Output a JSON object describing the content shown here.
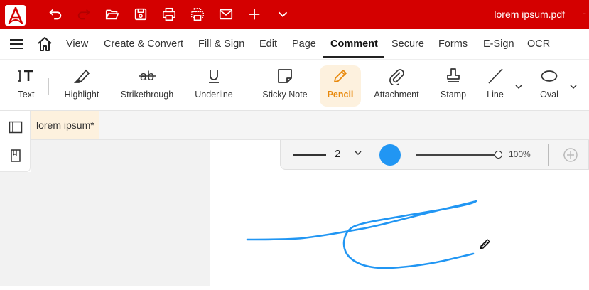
{
  "app": {
    "document_title": "lorem ipsum.pdf",
    "minimize": "-"
  },
  "menu": {
    "items": [
      "View",
      "Create & Convert",
      "Fill & Sign",
      "Edit",
      "Page",
      "Comment",
      "Secure",
      "Forms",
      "E-Sign",
      "OCR"
    ],
    "active": "Comment"
  },
  "toolbar": {
    "text": "Text",
    "highlight": "Highlight",
    "strikethrough": "Strikethrough",
    "underline": "Underline",
    "sticky_note": "Sticky Note",
    "pencil": "Pencil",
    "attachment": "Attachment",
    "stamp": "Stamp",
    "line": "Line",
    "oval": "Oval"
  },
  "tab": {
    "label": "lorem ipsum",
    "modified_marker": "*"
  },
  "pencil_options": {
    "thickness": "2",
    "color": "#2196f3",
    "opacity": "100%",
    "opacity_value": 1.0
  },
  "colors": {
    "brand": "#d40000",
    "accent": "#e8890c",
    "active_bg": "#fdf1de",
    "stroke": "#2196f3"
  },
  "icons": [
    "app-logo-icon",
    "undo-icon",
    "redo-icon",
    "open-folder-icon",
    "save-icon",
    "print-icon",
    "print-preview-icon",
    "mail-icon",
    "add-icon",
    "chevron-down-icon",
    "hamburger-menu-icon",
    "home-icon",
    "pencil-cursor-icon"
  ]
}
